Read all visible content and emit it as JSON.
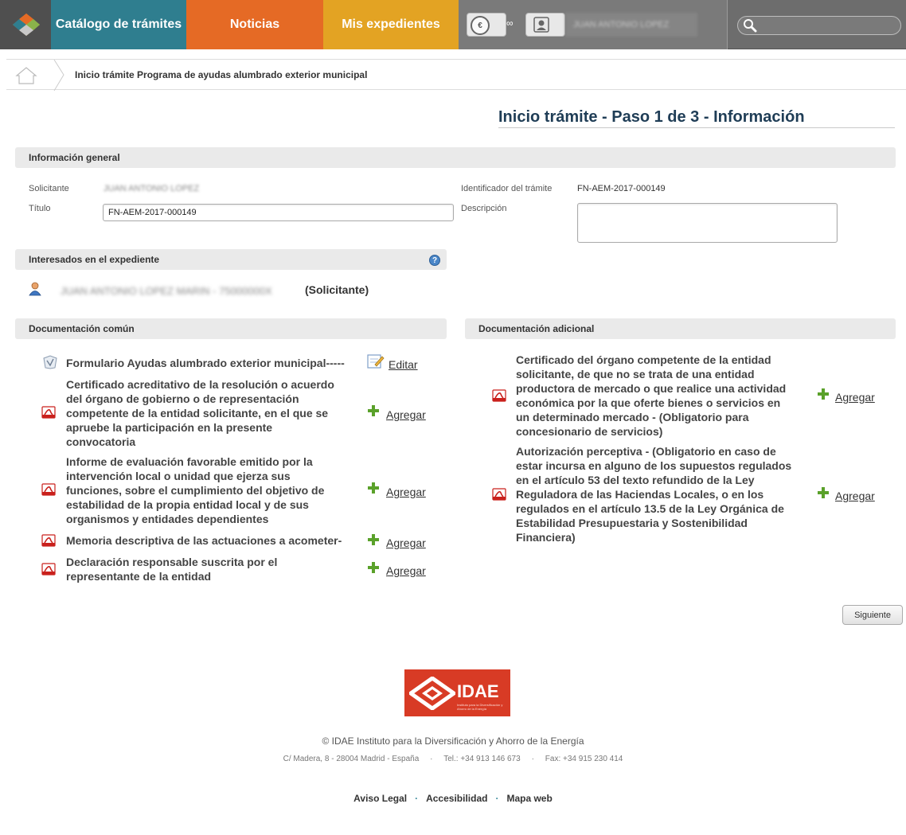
{
  "nav": {
    "tabs": [
      "Catálogo de trámites",
      "Noticias",
      "Mis expedientes"
    ],
    "user_link_glyph": "∞",
    "user_name": "JUAN ANTONIO LOPEZ",
    "search_placeholder": ""
  },
  "breadcrumb": {
    "current": "Inicio trámite Programa de ayudas alumbrado exterior municipal"
  },
  "page_title": "Inicio trámite - Paso 1 de 3 - Información",
  "general": {
    "heading": "Información general",
    "solicitante_label": "Solicitante",
    "solicitante_value": "JUAN ANTONIO LOPEZ",
    "titulo_label": "Título",
    "titulo_value": "FN-AEM-2017-000149",
    "identificador_label": "Identificador del trámite",
    "identificador_value": "FN-AEM-2017-000149",
    "descripcion_label": "Descripción",
    "descripcion_value": ""
  },
  "interesados": {
    "heading": "Interesados en el expediente",
    "help_glyph": "?",
    "person_name": "JUAN ANTONIO LOPEZ MARIN - 75000000X",
    "person_role": "(Solicitante)"
  },
  "comun": {
    "heading": "Documentación común",
    "docs": [
      {
        "lines": [
          "Formulario Ayudas alumbrado exterior municipal-----"
        ],
        "action": "Editar"
      },
      {
        "lines": [
          "Certificado acreditativo de la resolución o acuerdo",
          "del órgano de gobierno o de representación",
          "competente de la entidad solicitante, en el que se",
          "apruebe la participación en la presente",
          "convocatoria"
        ],
        "action": "Agregar"
      },
      {
        "lines": [
          "Informe de evaluación favorable emitido por la",
          "intervención local o unidad que ejerza sus",
          "funciones, sobre el cumplimiento del objetivo de",
          "estabilidad de la propia entidad local y de sus",
          "organismos y entidades dependientes"
        ],
        "action": "Agregar"
      },
      {
        "lines": [
          "Memoria descriptiva de las actuaciones a acometer-"
        ],
        "action": "Agregar"
      },
      {
        "lines": [
          "Declaración responsable suscrita por el",
          "representante de la entidad"
        ],
        "action": "Agregar"
      }
    ]
  },
  "adicional": {
    "heading": "Documentación adicional",
    "docs": [
      {
        "lines": [
          "Certificado del órgano competente de la entidad",
          "solicitante, de que no se trata de una entidad",
          "productora de mercado o que realice una actividad",
          "económica por la que oferte bienes o servicios en",
          "un determinado mercado - (Obligatorio para",
          "concesionario de servicios)"
        ],
        "action": "Agregar"
      },
      {
        "lines": [
          "Autorización perceptiva - (Obligatorio en caso de",
          "estar incursa en alguno de los supuestos regulados",
          "en el artículo 53 del texto refundido de la Ley",
          "Reguladora de las Haciendas Locales, o en los",
          "regulados en el artículo 13.5 de la Ley Orgánica de",
          "Estabilidad Presupuestaria y Sostenibilidad",
          "Financiera)"
        ],
        "action": "Agregar"
      }
    ]
  },
  "buttons": {
    "next": "Siguiente"
  },
  "footer": {
    "logo_text": "IDAE",
    "logo_small": "Instituto para la Diversificación y Ahorro de la Energía",
    "copyright": "© IDAE Instituto para la Diversificación y Ahorro de la Energía",
    "address": "C/ Madera, 8 - 28004 Madrid - España     ·     Tel.: +34 913 146 673     ·     Fax: +34 915 230 414",
    "links": [
      "Aviso Legal",
      "Accesibilidad",
      "Mapa web"
    ]
  },
  "colors": {
    "catalogo": "#2f7e8f",
    "noticias": "#e56a25",
    "expedientes": "#e3a323",
    "title": "#1f3d56",
    "idae_red": "#d83b25"
  }
}
